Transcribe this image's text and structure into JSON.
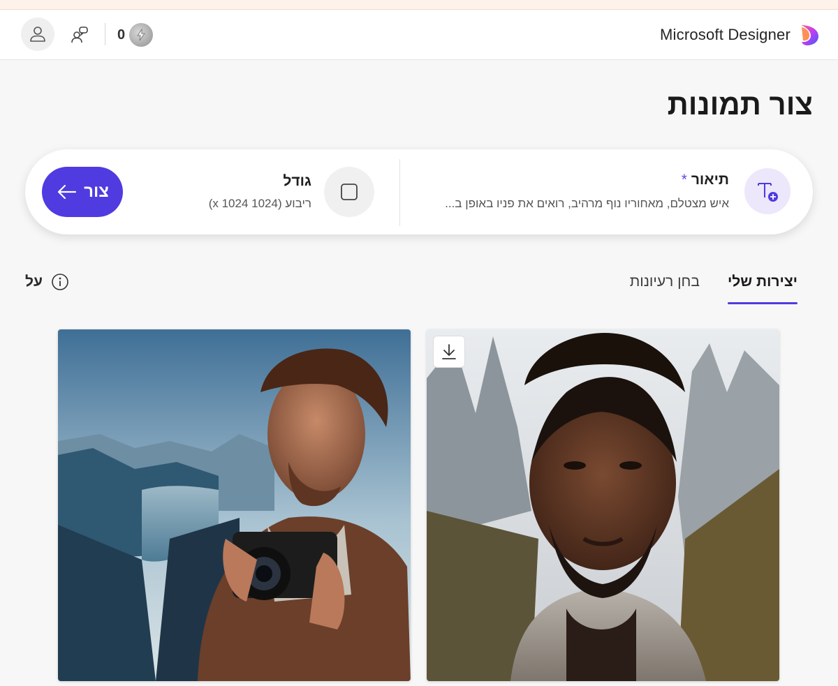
{
  "header": {
    "brand_name": "Microsoft Designer",
    "credits_count": "0"
  },
  "page": {
    "title": "צור תמונות"
  },
  "prompt_bar": {
    "description_title": "תיאור",
    "description_required": "*",
    "description_text": "איש מצטלם, מאחוריו נוף מרהיב, רואים את פניו באופן ב...",
    "size_title": "גודל",
    "size_value": "ריבוע (1024 x 1024)",
    "create_label": "צור"
  },
  "tabs": [
    {
      "label": "בחן רעיונות",
      "active": false
    },
    {
      "label": "יצירות שלי",
      "active": true
    }
  ],
  "about_label": "על",
  "colors": {
    "accent": "#4f3be0",
    "description_icon_bg": "#ece7fb"
  },
  "icons": {
    "brand": "designer-logo-icon",
    "profile": "person-icon",
    "share": "people-share-icon",
    "boost": "boost-coin-icon",
    "description": "text-add-icon",
    "size": "square-icon",
    "create": "arrow-left-icon",
    "info": "info-icon",
    "download": "download-icon"
  }
}
